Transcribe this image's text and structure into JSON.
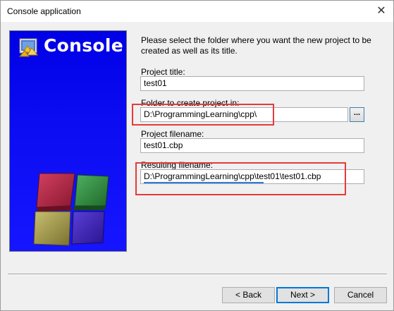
{
  "window": {
    "title": "Console application",
    "close_glyph": "✕"
  },
  "banner": {
    "title": "Console",
    "logo_icon": "codeblocks-logo-icon",
    "graphic": "cube-blocks-graphic",
    "colors": {
      "background": "#0000e6",
      "cube_red": "#b0203a",
      "cube_green": "#2f8a3a",
      "cube_yellow": "#a8a040",
      "cube_purple": "#3a1fb0"
    }
  },
  "form": {
    "instructions": "Please select the folder where you want the new project to be created as well as its title.",
    "project_title_label": "Project title:",
    "project_title_value": "test01",
    "folder_label": "Folder to create project in:",
    "folder_value": "D:\\ProgrammingLearning\\cpp\\",
    "browse_label": "...",
    "filename_label": "Project filename:",
    "filename_value": "test01.cbp",
    "resulting_label": "Resulting filename:",
    "resulting_value": "D:\\ProgrammingLearning\\cpp\\test01\\test01.cbp"
  },
  "buttons": {
    "back": "< Back",
    "next": "Next >",
    "cancel": "Cancel"
  },
  "annotation_colors": {
    "box": "#e33b3b",
    "underline": "#2f7fd6"
  }
}
